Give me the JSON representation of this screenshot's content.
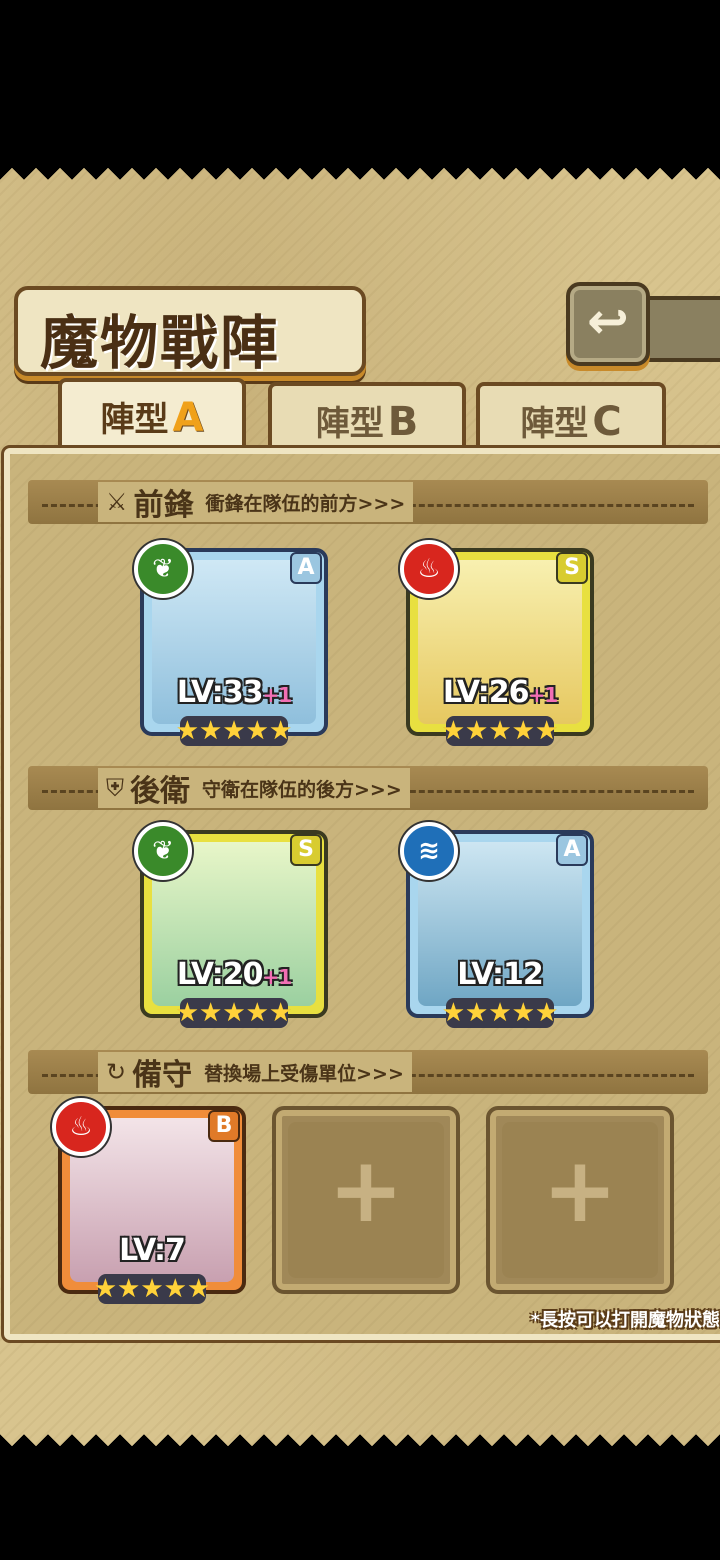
{
  "title": "魔物戰陣",
  "back_icon": "↩",
  "tabs": [
    {
      "label": "陣型",
      "letter": "A",
      "active": true
    },
    {
      "label": "陣型",
      "letter": "B",
      "active": false
    },
    {
      "label": "陣型",
      "letter": "C",
      "active": false
    }
  ],
  "sections": {
    "front": {
      "name": "前鋒",
      "desc": "衝鋒在隊伍的前方>>>",
      "icon": "sword-icon"
    },
    "rear": {
      "name": "後衛",
      "desc": "守衛在隊伍的後方>>>",
      "icon": "shield-icon"
    },
    "reserve": {
      "name": "備守",
      "desc": "替換場上受傷單位>>>",
      "icon": "swap-icon"
    }
  },
  "units": [
    {
      "slot": "front-1",
      "rank": "A",
      "attribute": "leaf",
      "attribute_color": "#3a8a2a",
      "level": "LV:33",
      "bonus": "+1",
      "stars": "★★★★★",
      "frame": "blue"
    },
    {
      "slot": "front-2",
      "rank": "S",
      "attribute": "fire",
      "attribute_color": "#d8261e",
      "level": "LV:26",
      "bonus": "+1",
      "stars": "★★★★★",
      "frame": "yellow"
    },
    {
      "slot": "rear-1",
      "rank": "S",
      "attribute": "leaf",
      "attribute_color": "#3a8a2a",
      "level": "LV:20",
      "bonus": "+1",
      "stars": "★★★★★",
      "frame": "yellow"
    },
    {
      "slot": "rear-2",
      "rank": "A",
      "attribute": "water",
      "attribute_color": "#1f6fb8",
      "level": "LV:12",
      "bonus": "",
      "stars": "★★★★★",
      "frame": "blue"
    },
    {
      "slot": "reserve-1",
      "rank": "B",
      "attribute": "fire",
      "attribute_color": "#d8261e",
      "level": "LV:7",
      "bonus": "",
      "stars": "★★★★★",
      "frame": "orange"
    }
  ],
  "empty_slot_symbol": "+",
  "footnote": "*長按可以打開魔物狀態"
}
